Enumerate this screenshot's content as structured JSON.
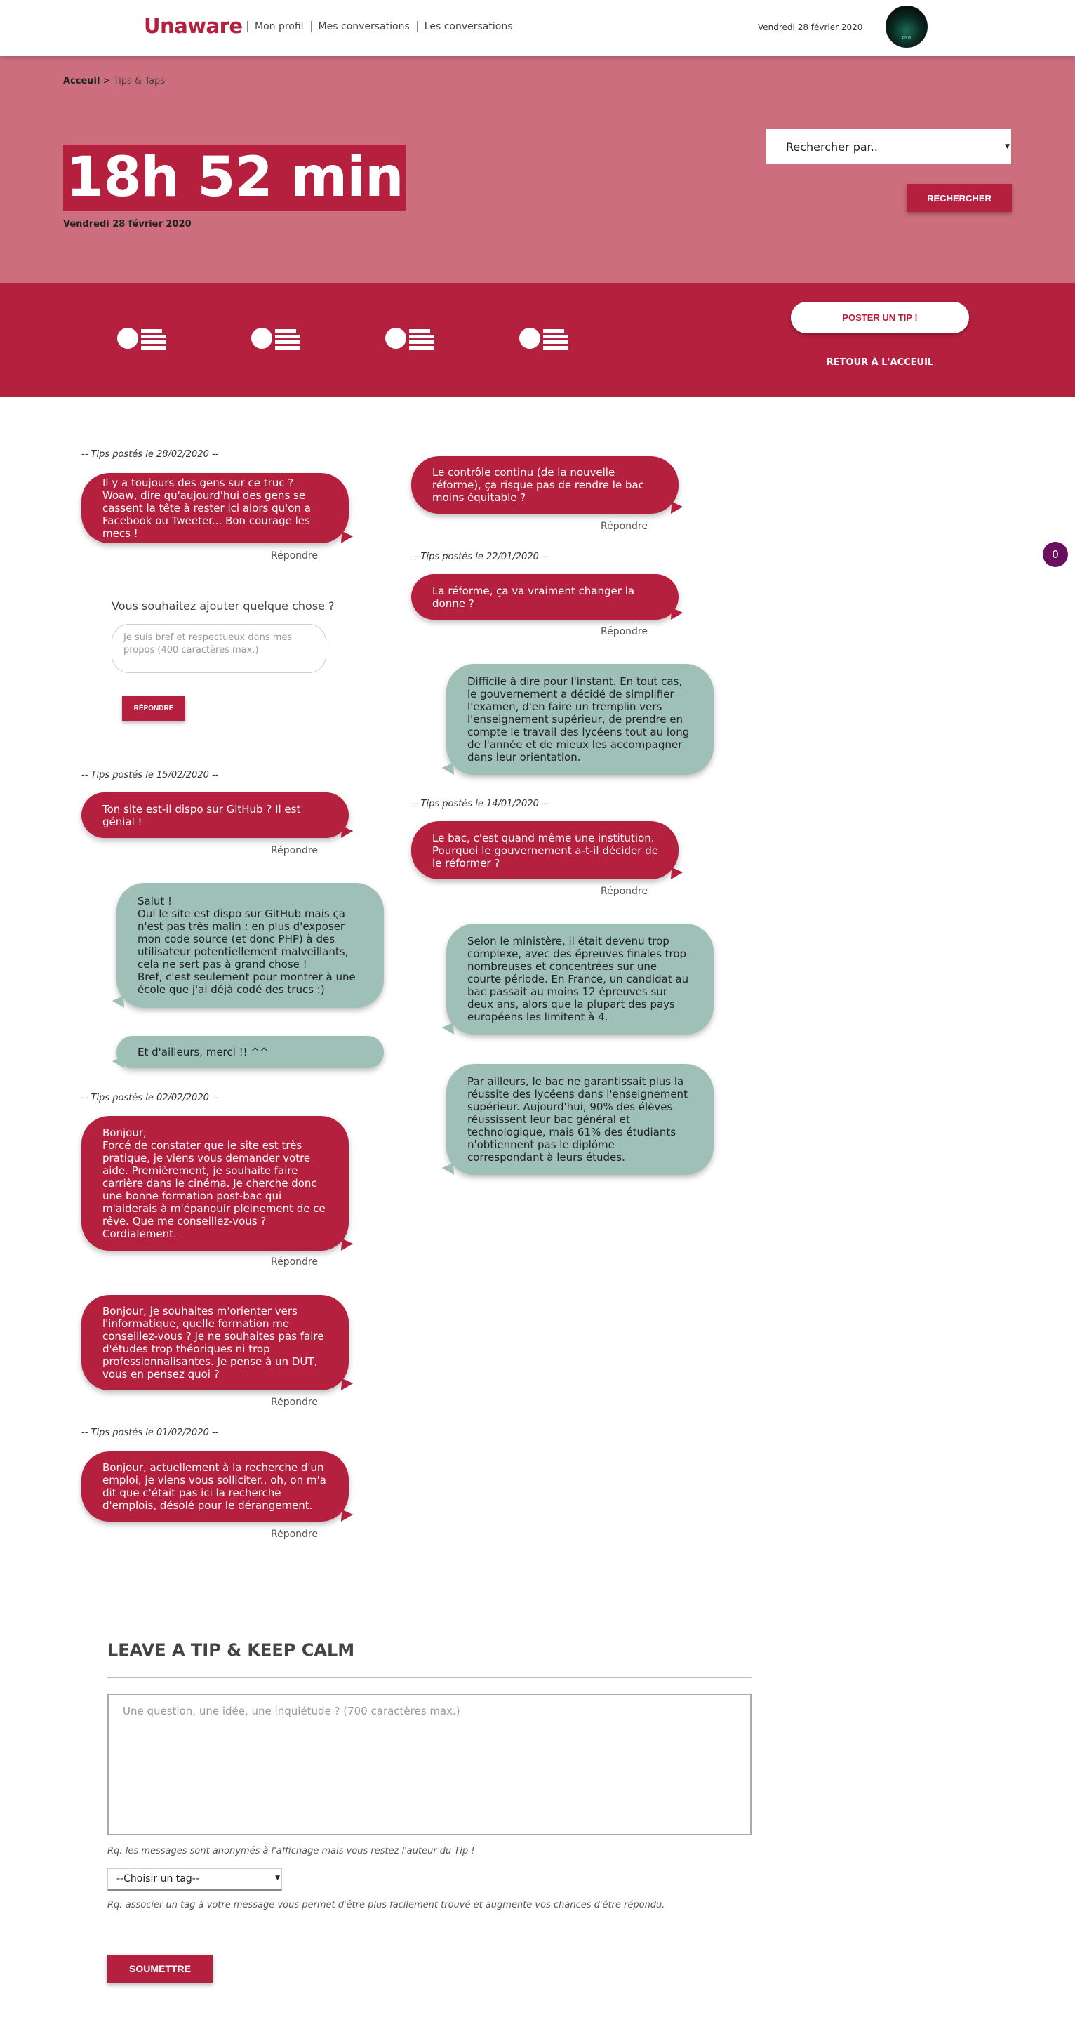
{
  "nav": {
    "logo": "Unaware",
    "links": [
      "Mon profil",
      "Mes conversations",
      "Les conversations"
    ],
    "date": "Vendredi 28 février 2020",
    "avatar_text": "BMW"
  },
  "hero": {
    "breadcrumb_home": "Acceuil",
    "breadcrumb_sep": " > ",
    "breadcrumb_current": "Tips & Taps",
    "clock": "18h 52 min",
    "date": "Vendredi 28 février 2020",
    "search_placeholder": "Rechercher par..",
    "search_button": "RECHERCHER"
  },
  "band": {
    "post_button": "POSTER UN TIP !",
    "back_link": "RETOUR À L'ACCEUIL",
    "icons": [
      "list-icon",
      "list-icon",
      "list-icon",
      "list-icon"
    ]
  },
  "colors": {
    "accent": "#b5203f",
    "hero": "#cc6e7e",
    "answer": "#9fc0b7",
    "badge": "#6a0f5e"
  },
  "conversations": {
    "reply_label": "Répondre",
    "left": {
      "g1_head": "-- Tips postés le 28/02/2020 --",
      "g1_q1": "Il y a toujours des gens sur ce truc ? Woaw, dire qu'aujourd'hui des gens se cassent la tête à rester ici alors qu'on a Facebook ou Tweeter... Bon courage les mecs !",
      "g2_head": "-- Tips postés le 15/02/2020 --",
      "g2_q1": "Ton site est-il dispo sur GitHub ? Il est génial !",
      "g2_a1": "Salut !\nOui le site est dispo sur GitHub mais ça n'est pas très malin : en plus d'exposer mon code source (et donc PHP) à des utilisateur potentiellement malveillants, cela ne sert pas à grand chose !\nBref, c'est seulement pour montrer à une école que j'ai déjà codé des trucs :)",
      "g2_a2": "Et d'ailleurs, merci !! ^^",
      "g3_head": "-- Tips postés le 02/02/2020 --",
      "g3_q1": "Bonjour,\nForcé de constater que le site est très pratique, je viens vous demander votre aide. Premièrement, je souhaite faire carrière dans le cinéma. Je cherche donc une bonne formation post-bac qui m'aiderais à m'épanouir pleinement de ce rêve. Que me conseillez-vous ?\nCordialement.",
      "g3_q2": "Bonjour, je souhaites m'orienter vers l'informatique, quelle formation me conseillez-vous ? Je ne souhaites pas faire d'études trop théoriques ni trop professionnalisantes. Je pense à un DUT, vous en pensez quoi ?",
      "g4_head": "-- Tips postés le 01/02/2020 --",
      "g4_q1": "Bonjour, actuellement à la recherche d'un emploi, je viens vous solliciter.. oh, on m'a dit que c'était pas ici la recherche d'emplois, désolé pour le dérangement."
    },
    "right": {
      "g1_q1": "Le contrôle continu (de la nouvelle réforme), ça risque pas de rendre le bac moins équitable ?",
      "g2_head": "-- Tips postés le 22/01/2020 --",
      "g2_q1": "La réforme, ça va vraiment changer la donne ?",
      "g2_a1": "Difficile à dire pour l'instant. En tout cas, le gouvernement a décidé de simplifier l'examen, d'en faire un tremplin vers l'enseignement supérieur, de prendre en compte le travail des lycéens tout au long de l'année et de mieux les accompagner dans leur orientation.",
      "g3_head": "-- Tips postés le 14/01/2020 --",
      "g3_q1": "Le bac, c'est quand même une institution. Pourquoi le gouvernement a-t-il décider de le réformer ?",
      "g3_a1": "Selon le ministère, il était devenu trop complexe, avec des épreuves finales trop nombreuses et concentrées sur une courte période. En France, un candidat au bac passait au moins 12 épreuves sur deux ans, alors que la plupart des pays européens les limitent à 4.",
      "g3_a2": "Par ailleurs, le bac ne garantissait plus la réussite des lycéens dans l'enseignement supérieur. Aujourd'hui, 90% des élèves réussissent leur bac général et technologique, mais 61% des étudiants n'obtiennent pas le diplôme correspondant à leurs études."
    },
    "ask_label": "Vous souhaitez ajouter quelque chose ?",
    "ask_placeholder": "Je suis bref et respectueux dans mes propos (400 caractères max.)",
    "ask_button": "RÉPONDRE"
  },
  "badge_count": "0",
  "form": {
    "title": "LEAVE A TIP & KEEP CALM",
    "placeholder": "Une question, une idée, une inquiétude ? (700 caractères max.)",
    "note1": "Rq: les messages sont anonymés à l'affichage mais vous restez l'auteur du Tip !",
    "select": "--Choisir un tag--",
    "note2": "Rq: associer un tag à votre message vous permet d'être plus facilement trouvé et augmente vos chances d'être répondu.",
    "submit": "SOUMETTRE"
  }
}
